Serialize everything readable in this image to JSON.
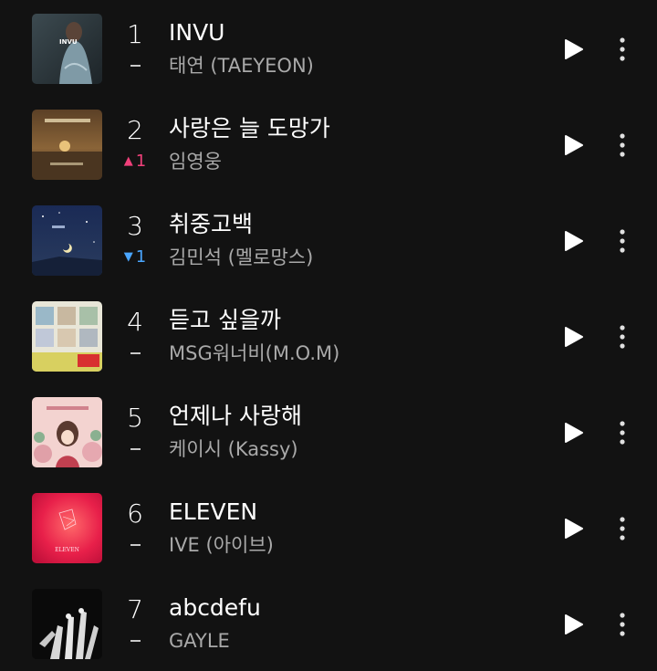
{
  "chart": {
    "tracks": [
      {
        "rank": "1",
        "title": "INVU",
        "artist": "태연 (TAEYEON)",
        "change_type": "none",
        "change_value": "",
        "art_label": "INVU"
      },
      {
        "rank": "2",
        "title": "사랑은 늘 도망가",
        "artist": "임영웅",
        "change_type": "up",
        "change_value": "1",
        "art_label": ""
      },
      {
        "rank": "3",
        "title": "취중고백",
        "artist": "김민석 (멜로망스)",
        "change_type": "down",
        "change_value": "1",
        "art_label": ""
      },
      {
        "rank": "4",
        "title": "듣고 싶을까",
        "artist": "MSG워너비(M.O.M)",
        "change_type": "none",
        "change_value": "",
        "art_label": ""
      },
      {
        "rank": "5",
        "title": "언제나 사랑해",
        "artist": "케이시 (Kassy)",
        "change_type": "none",
        "change_value": "",
        "art_label": ""
      },
      {
        "rank": "6",
        "title": "ELEVEN",
        "artist": "IVE (아이브)",
        "change_type": "none",
        "change_value": "",
        "art_label": "ELEVEN"
      },
      {
        "rank": "7",
        "title": "abcdefu",
        "artist": "GAYLE",
        "change_type": "none",
        "change_value": "",
        "art_label": ""
      }
    ]
  },
  "icons": {
    "play": "play-icon",
    "more": "more-vertical-icon",
    "up": "triangle-up-icon",
    "down": "triangle-down-icon"
  },
  "colors": {
    "background": "#121212",
    "up": "#f0407a",
    "down": "#4aa6ff",
    "artist_text": "#a9a9a9"
  }
}
